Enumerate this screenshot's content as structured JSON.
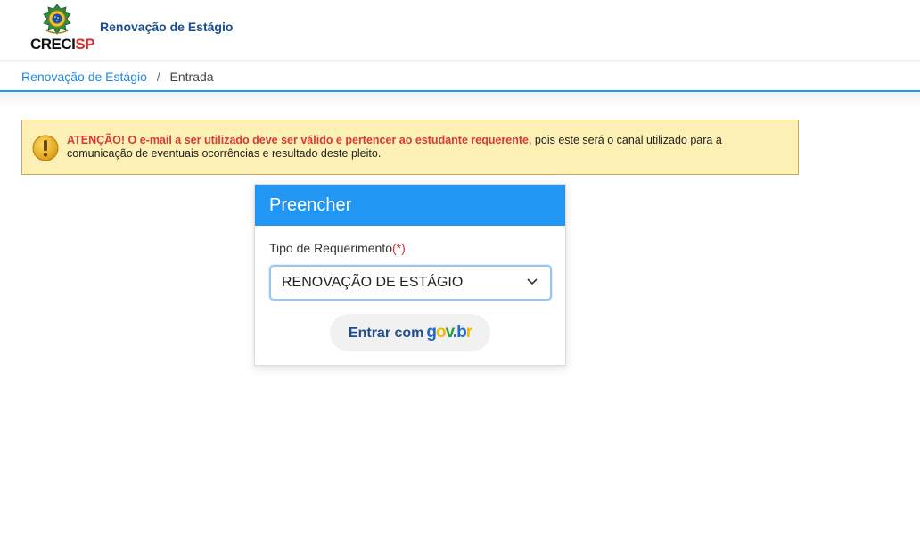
{
  "header": {
    "brand_part1": "CRECI",
    "brand_part2": "SP",
    "title": "Renovação de Estágio"
  },
  "breadcrumb": {
    "link": "Renovação de Estágio",
    "separator": "/",
    "current": "Entrada"
  },
  "alert": {
    "warning": "ATENÇÃO! O e-mail a ser utilizado deve ser válido e pertencer ao estudante requerente",
    "message": ", pois este será o canal utilizado para a comunicação de eventuais ocorrências e resultado deste pleito."
  },
  "card": {
    "title": "Preencher",
    "field_label": "Tipo de Requerimento",
    "required_mark": "(*)",
    "selected_value": "RENOVAÇÃO DE ESTÁGIO",
    "login_button_text": "Entrar com",
    "login_logo": [
      "g",
      "o",
      "v",
      ".",
      "b",
      "r"
    ]
  },
  "icons": {
    "brand": "coat-of-arms-icon",
    "alert": "exclamation-icon",
    "select": "chevron-down-icon"
  },
  "colors": {
    "accent": "#2196f3",
    "link": "#1e88e5",
    "warning_text": "#d63a3a",
    "alert_background": "#fdf0b5"
  }
}
